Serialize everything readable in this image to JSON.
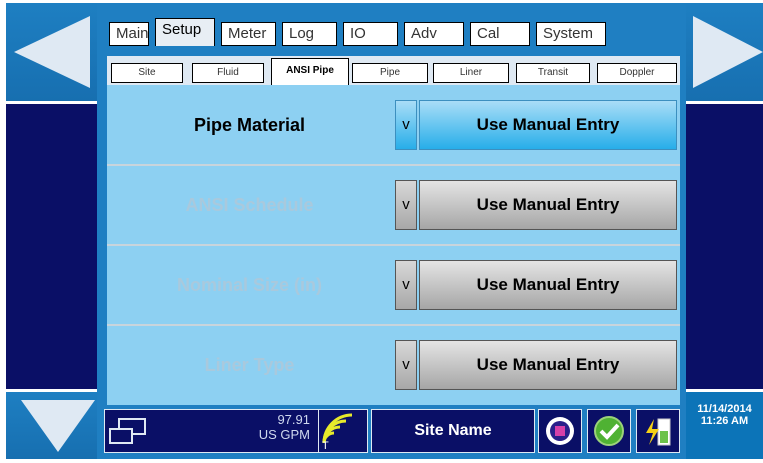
{
  "nav": {
    "left_icon": "arrow-left-icon",
    "right_icon": "arrow-right-icon",
    "down_icon": "arrow-down-icon"
  },
  "main_tabs": [
    "Main",
    "Setup",
    "Meter",
    "Log",
    "IO",
    "Adv",
    "Cal",
    "System"
  ],
  "active_main_tab": "Setup",
  "sub_tabs": [
    "Site",
    "Fluid",
    "ANSI Pipe",
    "Pipe",
    "Liner",
    "Transit",
    "Doppler"
  ],
  "active_sub_tab": "ANSI Pipe",
  "rows": [
    {
      "label": "Pipe Material",
      "dropdown_symbol": "v",
      "value": "Use Manual Entry"
    },
    {
      "label": "ANSI Schedule",
      "dropdown_symbol": "v",
      "value": "Use Manual Entry"
    },
    {
      "label": "Nominal Size (in)",
      "dropdown_symbol": "v",
      "value": "Use Manual Entry"
    },
    {
      "label": "Liner Type",
      "dropdown_symbol": "v",
      "value": "Use Manual Entry"
    }
  ],
  "status": {
    "display_icon": "display-windows-icon",
    "rate_value": "97.91",
    "rate_unit": "US GPM",
    "signal_icon": "signal-strength-icon",
    "signal_label": "T",
    "site_name": "Site Name",
    "stop_icon": "stop-record-icon",
    "ok_icon": "checkmark-icon",
    "battery_icon": "power-charging-icon",
    "date": "11/14/2014",
    "time": "11:26 AM"
  },
  "colors": {
    "frame_blue": "#1f7fc2",
    "dark_navy": "#0a0f66",
    "content_bg": "#8dd0f2",
    "active_button": "#27aee9"
  }
}
